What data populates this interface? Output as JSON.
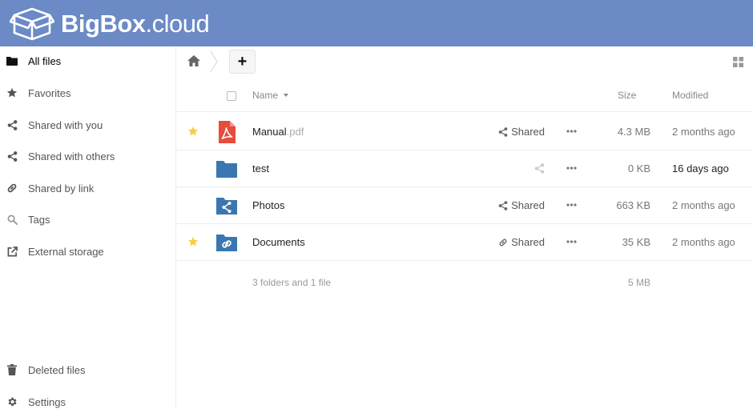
{
  "brand": {
    "name_bold": "Big",
    "name_mid": "Box",
    "name_thin": ".cloud",
    "header_color": "#6b8ac6"
  },
  "sidebar": {
    "items": [
      {
        "label": "All files",
        "icon": "folder-icon",
        "active": true
      },
      {
        "label": "Favorites",
        "icon": "star-icon"
      },
      {
        "label": "Shared with you",
        "icon": "share-icon"
      },
      {
        "label": "Shared with others",
        "icon": "share-icon"
      },
      {
        "label": "Shared by link",
        "icon": "link-icon"
      },
      {
        "label": "Tags",
        "icon": "search-icon"
      },
      {
        "label": "External storage",
        "icon": "external-icon"
      }
    ],
    "bottom": [
      {
        "label": "Deleted files",
        "icon": "trash-icon"
      },
      {
        "label": "Settings",
        "icon": "gear-icon"
      }
    ]
  },
  "toolbar": {
    "new_label": "+"
  },
  "table": {
    "headers": {
      "name": "Name",
      "size": "Size",
      "modified": "Modified"
    },
    "rows": [
      {
        "name": "Manual",
        "ext": ".pdf",
        "type": "pdf-icon",
        "favorite": true,
        "share_label": "Shared",
        "share_type": "share",
        "size": "4.3 MB",
        "modified": "2 months ago"
      },
      {
        "name": "test",
        "ext": "",
        "type": "folder-icon",
        "favorite": false,
        "share_label": "",
        "share_type": "share-faded",
        "size": "0 KB",
        "modified": "16 days ago",
        "recent": true
      },
      {
        "name": "Photos",
        "ext": "",
        "type": "shared-folder-icon",
        "favorite": false,
        "share_label": "Shared",
        "share_type": "share",
        "size": "663 KB",
        "modified": "2 months ago"
      },
      {
        "name": "Documents",
        "ext": "",
        "type": "link-folder-icon",
        "favorite": true,
        "share_label": "Shared",
        "share_type": "link",
        "size": "35 KB",
        "modified": "2 months ago"
      }
    ],
    "summary": {
      "text": "3 folders and 1 file",
      "size": "5 MB"
    }
  },
  "colors": {
    "folder": "#3a77b0",
    "pdf": "#e74c3c",
    "star": "#f8cd46"
  }
}
